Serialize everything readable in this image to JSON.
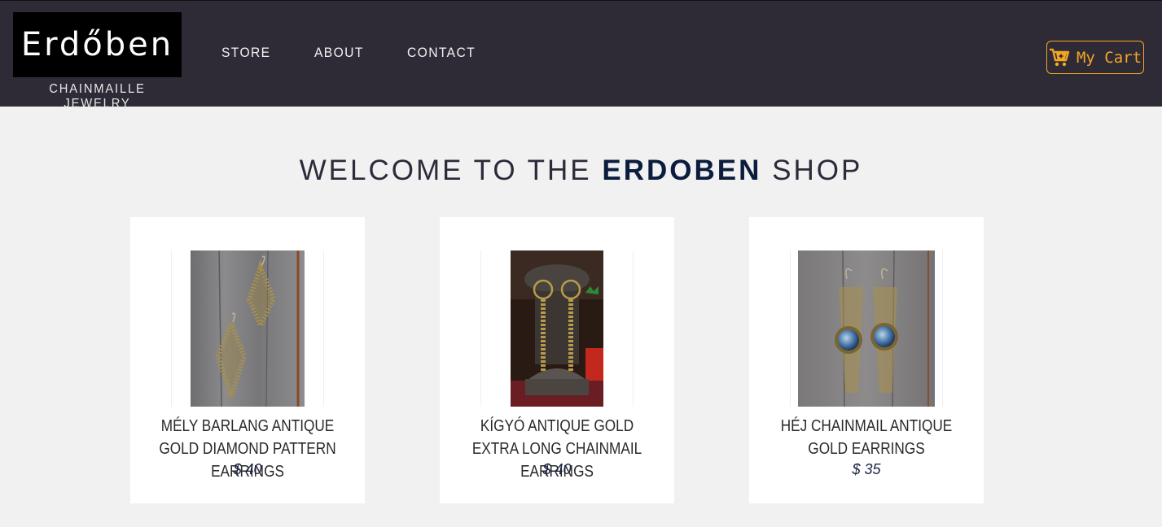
{
  "header": {
    "logo": "Erdőben",
    "tagline": "CHAINMAILLE JEWELRY",
    "nav": [
      "STORE",
      "ABOUT",
      "CONTACT"
    ],
    "cart_label": "My Cart",
    "accent_color": "#f5a623"
  },
  "main": {
    "welcome_prefix": "WELCOME TO THE",
    "welcome_brand": "ERDOBEN",
    "welcome_suffix": "SHOP"
  },
  "products": [
    {
      "title": "MÉLY BARLANG ANTIQUE GOLD DIAMOND PATTERN EARRINGS",
      "price": "$ 40"
    },
    {
      "title": "KÍGYÓ ANTIQUE GOLD EXTRA LONG CHAINMAIL EARRINGS",
      "price": "$ 40"
    },
    {
      "title": "HÉJ CHAINMAIL ANTIQUE GOLD EARRINGS",
      "price": "$ 35"
    }
  ]
}
